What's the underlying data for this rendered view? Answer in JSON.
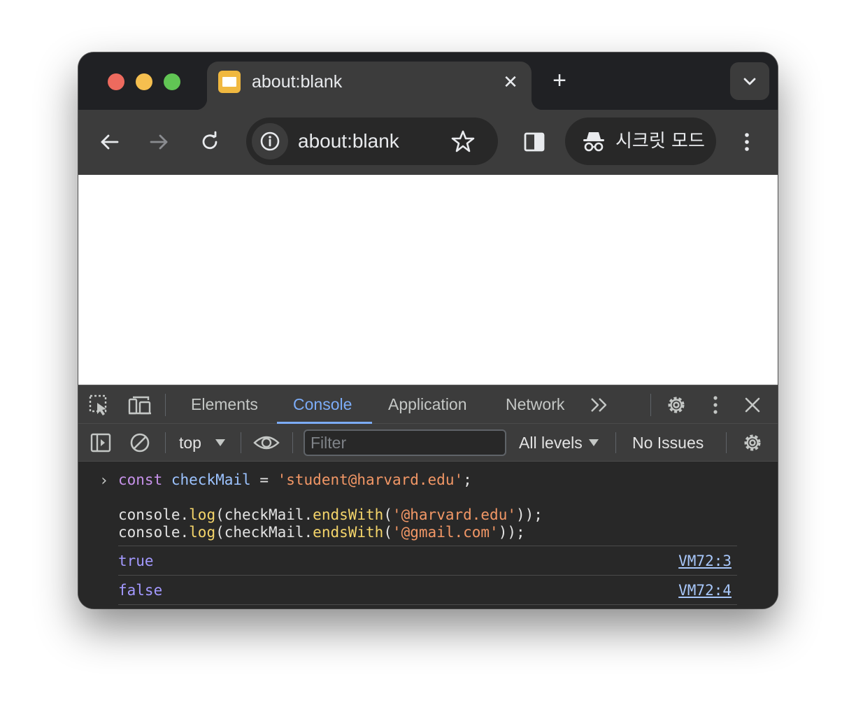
{
  "tab": {
    "title": "about:blank",
    "close_glyph": "✕"
  },
  "new_tab_glyph": "+",
  "address_bar": {
    "url": "about:blank"
  },
  "incognito": {
    "label": "시크릿 모드"
  },
  "devtools": {
    "tabs": [
      "Elements",
      "Console",
      "Application",
      "Network"
    ],
    "active_tab": "Console",
    "more_tabs_glyph": "»",
    "console_toolbar": {
      "context": "top",
      "filter_placeholder": "Filter",
      "levels": "All levels",
      "issues": "No Issues"
    },
    "console": {
      "prompt": "›",
      "input": {
        "line1": {
          "kw": "const",
          "var": "checkMail",
          "op": " = ",
          "str": "'student@harvard.edu'",
          "end": ";"
        },
        "line2": {
          "obj": "console.",
          "fn": "log",
          "open": "(checkMail.",
          "method": "endsWith",
          "paren": "(",
          "arg": "'@harvard.edu'",
          "close": "));"
        },
        "line3": {
          "obj": "console.",
          "fn": "log",
          "open": "(checkMail.",
          "method": "endsWith",
          "paren": "(",
          "arg": "'@gmail.com'",
          "close": "));"
        }
      },
      "outputs": [
        {
          "value": "true",
          "source": "VM72:3"
        },
        {
          "value": "false",
          "source": "VM72:4"
        }
      ]
    }
  },
  "colors": {
    "frame": "#202124",
    "toolbar": "#3c3c3c",
    "active_tab_accent": "#7cacf8",
    "keyword": "#c792ea",
    "string": "#f29766",
    "function": "#f5d56a",
    "boolean": "#a399ff"
  },
  "icons": {
    "back": "arrow-left-icon",
    "forward": "arrow-right-icon",
    "reload": "reload-icon",
    "site_info": "info-icon",
    "bookmark": "star-icon",
    "side_panel": "side-panel-icon",
    "incognito": "incognito-icon",
    "menu": "kebab-menu-icon",
    "inspect": "inspect-element-icon",
    "device": "device-toolbar-icon",
    "settings": "gear-icon",
    "close": "close-icon",
    "sidebar": "sidebar-toggle-icon",
    "clear": "clear-console-icon",
    "eye": "eye-icon"
  }
}
